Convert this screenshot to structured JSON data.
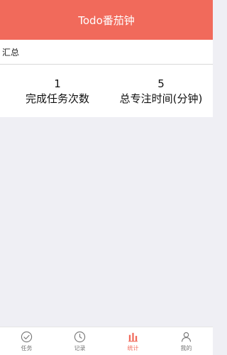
{
  "header": {
    "title": "Todo番茄钟"
  },
  "summary": {
    "label": "汇总"
  },
  "stats": [
    {
      "value": "1",
      "label": "完成任务次数"
    },
    {
      "value": "5",
      "label": "总专注时间(分钟)"
    }
  ],
  "tabs": [
    {
      "label": "任务",
      "icon": "check-circle-icon"
    },
    {
      "label": "记录",
      "icon": "clock-icon"
    },
    {
      "label": "统计",
      "icon": "bar-chart-icon"
    },
    {
      "label": "我的",
      "icon": "user-icon"
    }
  ],
  "colors": {
    "accent": "#f16a5b",
    "inactive": "#777777",
    "background": "#efeff4"
  }
}
